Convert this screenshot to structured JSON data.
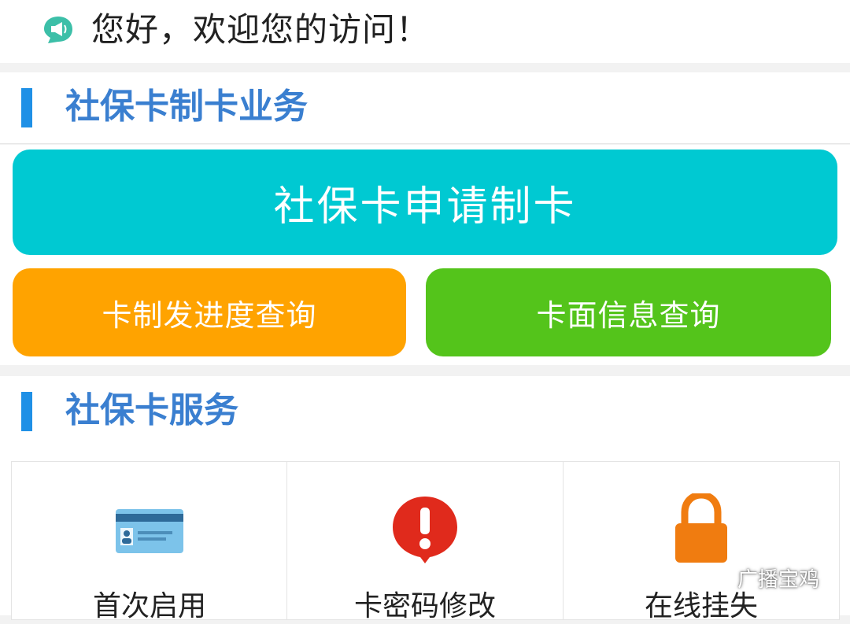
{
  "greeting": {
    "icon": "megaphone-icon",
    "text": "您好，欢迎您的访问！"
  },
  "section_card_making": {
    "title": "社保卡制卡业务"
  },
  "card_making_buttons": {
    "apply": "社保卡申请制卡",
    "progress": "卡制发进度查询",
    "info": "卡面信息查询"
  },
  "section_services": {
    "title": "社保卡服务"
  },
  "services": [
    {
      "label": "首次启用",
      "icon": "card-icon"
    },
    {
      "label": "卡密码修改",
      "icon": "alert-pin-icon"
    },
    {
      "label": "在线挂失",
      "icon": "lock-icon"
    }
  ],
  "watermark": {
    "icon": "wechat-icon",
    "text": "广播宝鸡"
  },
  "colors": {
    "accent_blue": "#1f90e6",
    "title_blue": "#3a7fd0",
    "apply_teal": "#00c9d2",
    "progress_orange": "#ffa300",
    "info_green": "#54c41b",
    "alert_red": "#e02a1c",
    "lock_orange": "#f07c10"
  }
}
